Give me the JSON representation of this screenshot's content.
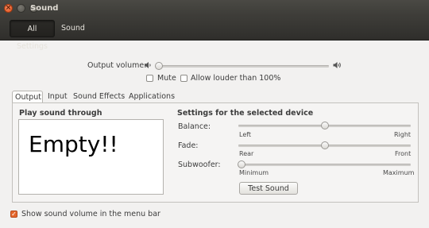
{
  "window": {
    "title": "Sound"
  },
  "toolbar": {
    "all_settings": "All Settings",
    "sound": "Sound"
  },
  "output_volume": {
    "label": "Output volume:",
    "level": 0.0
  },
  "mute": {
    "label": "Mute",
    "checked": false
  },
  "allow_louder": {
    "label": "Allow louder than 100%",
    "checked": false
  },
  "tabs": [
    "Output",
    "Input",
    "Sound Effects",
    "Applications"
  ],
  "play_through": {
    "title": "Play sound through",
    "content": "Empty!!"
  },
  "device_settings": {
    "title": "Settings for the selected device",
    "balance": {
      "label": "Balance:",
      "left": "Left",
      "right": "Right",
      "value": 0.5
    },
    "fade": {
      "label": "Fade:",
      "left": "Rear",
      "right": "Front",
      "value": 0.5
    },
    "subwoofer": {
      "label": "Subwoofer:",
      "left": "Minimum",
      "right": "Maximum",
      "value": 0.0
    },
    "test_button": "Test Sound"
  },
  "show_volume_menu": {
    "label": "Show sound volume in the menu bar",
    "checked": true
  },
  "colors": {
    "accent": "#e4662c",
    "titlebar": "#3c3b37"
  }
}
